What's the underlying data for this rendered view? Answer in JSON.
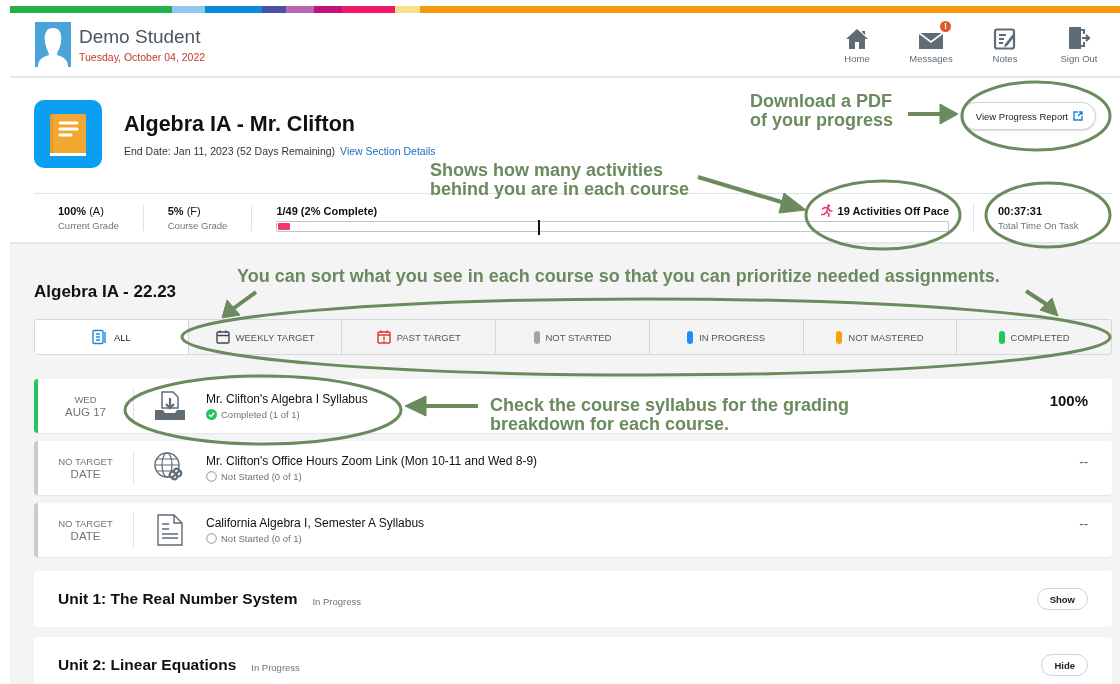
{
  "header": {
    "student_name": "Demo Student",
    "date": "Tuesday, October 04, 2022",
    "nav": [
      {
        "label": "Home",
        "kind": "home"
      },
      {
        "label": "Messages",
        "kind": "messages",
        "badge": "!"
      },
      {
        "label": "Notes",
        "kind": "notes"
      },
      {
        "label": "Sign Out",
        "kind": "signout"
      }
    ]
  },
  "course": {
    "title": "Algebra IA - Mr. Clifton",
    "end_date": "End Date: Jan 11, 2023 (52 Days Remaining)",
    "details_link": "View Section Details",
    "report_button": "View Progress Report",
    "stats": [
      {
        "value": "100%",
        "grade": "(A)",
        "label": "Current Grade"
      },
      {
        "value": "5%",
        "grade": "(F)",
        "label": "Course Grade"
      }
    ],
    "progress": {
      "label": "1/49 (2% Complete)",
      "level": 0.02
    },
    "pace_marker": {
      "level": 0.39
    },
    "off_pace": "19 Activities Off Pace",
    "time": {
      "value": "00:37:31",
      "label": "Total Time On Task"
    }
  },
  "section_title": "Algebra IA - 22.23",
  "filters": [
    {
      "label": "ALL",
      "kind": "all",
      "selected": true
    },
    {
      "label": "WEEKLY TARGET",
      "kind": "calendar",
      "selected": false
    },
    {
      "label": "PAST TARGET",
      "kind": "past",
      "selected": false
    },
    {
      "label": "NOT STARTED",
      "kind": "status",
      "color": "#a0a4a8",
      "selected": false
    },
    {
      "label": "IN PROGRESS",
      "kind": "status",
      "color": "#1e8ff0",
      "selected": false
    },
    {
      "label": "NOT MASTERED",
      "kind": "status",
      "color": "#f5a00c",
      "selected": false
    },
    {
      "label": "COMPLETED",
      "kind": "status",
      "color": "#22c55e",
      "selected": false
    }
  ],
  "activities": [
    {
      "date": [
        "WED",
        "AUG 17"
      ],
      "kind": "download",
      "title": "Mr. Clifton's Algebra I Syllabus",
      "status": "Completed (1 of 1)",
      "completed": true,
      "score": "100%"
    },
    {
      "date": [
        "NO TARGET",
        "DATE"
      ],
      "kind": "globe",
      "title": "Mr. Clifton's Office Hours Zoom Link (Mon 10-11 and Wed 8-9)",
      "status": "Not Started (0 of 1)",
      "completed": false,
      "score": "--"
    },
    {
      "date": [
        "NO TARGET",
        "DATE"
      ],
      "kind": "document",
      "title": "California Algebra I, Semester A Syllabus",
      "status": "Not Started (0 of 1)",
      "completed": false,
      "score": "--"
    }
  ],
  "units": [
    {
      "title": "Unit 1: The Real Number System",
      "status": "In Progress",
      "button": "Show"
    },
    {
      "title": "Unit 2: Linear Equations",
      "status": "In Progress",
      "button": "Hide"
    }
  ],
  "annotations": [
    {
      "lines": [
        "Download a PDF",
        "of your progress"
      ]
    },
    {
      "lines": [
        "Shows how many activities",
        "behind you are in each course"
      ]
    },
    {
      "lines": [
        "You can sort what you see in each course so that you can prioritize needed assignments."
      ]
    },
    {
      "lines": [
        "Check the course syllabus for the grading",
        "breakdown for each course."
      ]
    }
  ]
}
